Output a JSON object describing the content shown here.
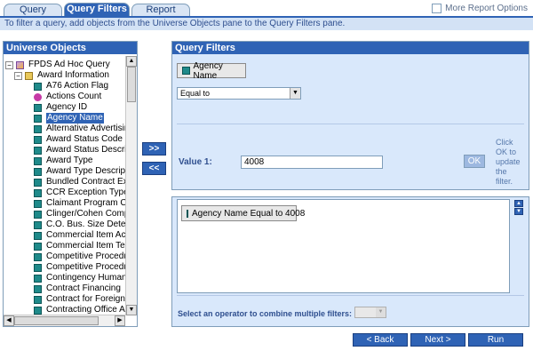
{
  "tabs": [
    {
      "label": "Query",
      "active": false
    },
    {
      "label": "Query Filters",
      "active": true
    },
    {
      "label": "Report",
      "active": false
    }
  ],
  "more_options_label": "More Report Options",
  "instruction": "To filter a query, add objects from the Universe Objects pane to the Query Filters pane.",
  "universe_panel": {
    "title": "Universe Objects",
    "root": {
      "label": "FPDS Ad Hoc Query",
      "icon": "universe-icon"
    },
    "folder": {
      "label": "Award Information",
      "icon": "folder-icon"
    },
    "items": [
      {
        "label": "A76 Action Flag",
        "icon": "dimension-icon"
      },
      {
        "label": "Actions Count",
        "icon": "measure-icon"
      },
      {
        "label": "Agency ID",
        "icon": "dimension-icon"
      },
      {
        "label": "Agency Name",
        "icon": "dimension-icon",
        "selected": true
      },
      {
        "label": "Alternative Advertising F",
        "icon": "dimension-icon"
      },
      {
        "label": "Award Status Code",
        "icon": "dimension-icon"
      },
      {
        "label": "Award Status Descriptio",
        "icon": "dimension-icon"
      },
      {
        "label": "Award Type",
        "icon": "dimension-icon"
      },
      {
        "label": "Award Type Description",
        "icon": "dimension-icon"
      },
      {
        "label": "Bundled Contract Excep",
        "icon": "dimension-icon"
      },
      {
        "label": "CCR Exception Type",
        "icon": "dimension-icon"
      },
      {
        "label": "Claimant Program Code",
        "icon": "dimension-icon"
      },
      {
        "label": "Clinger/Cohen Complianc",
        "icon": "dimension-icon"
      },
      {
        "label": "C.O. Bus. Size Determin",
        "icon": "dimension-icon"
      },
      {
        "label": "Commercial Item Acquisi",
        "icon": "dimension-icon"
      },
      {
        "label": "Commercial Item Test Pro",
        "icon": "dimension-icon"
      },
      {
        "label": "Competitive Procedures",
        "icon": "dimension-icon"
      },
      {
        "label": "Competitive Procedures",
        "icon": "dimension-icon"
      },
      {
        "label": "Contingency Humanitaria",
        "icon": "dimension-icon"
      },
      {
        "label": "Contract Financing",
        "icon": "dimension-icon"
      },
      {
        "label": "Contract for Foreign Ent",
        "icon": "dimension-icon"
      },
      {
        "label": "Contracting Office Agen",
        "icon": "dimension-icon"
      }
    ]
  },
  "move_buttons": {
    "add": ">>",
    "remove": "<<"
  },
  "query_filters": {
    "title": "Query Filters",
    "object_name": "Agency Name",
    "operator": "Equal to",
    "value_label": "Value 1:",
    "value": "4008",
    "ok_label": "OK",
    "ok_hint": "Click OK to update the filter."
  },
  "filter_list": {
    "filters": [
      "Agency Name Equal to 4008"
    ],
    "combine_label": "Select an operator to combine multiple filters:",
    "combine_value": ""
  },
  "footer": {
    "back": "< Back",
    "next": "Next >",
    "run": "Run"
  },
  "colors": {
    "accent": "#2f63b5",
    "panel_bg": "#d9e8fb",
    "instruction_bg": "#d3e2f5"
  }
}
